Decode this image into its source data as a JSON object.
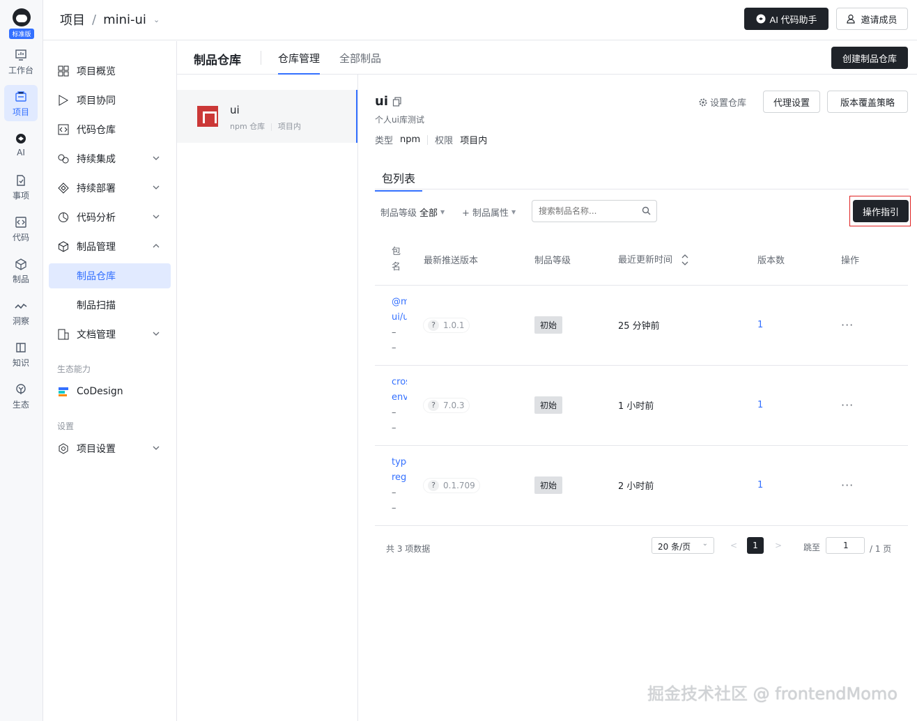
{
  "rail": {
    "edition": "标准版",
    "items": [
      {
        "label": "工作台",
        "icon": "workbench-icon"
      },
      {
        "label": "项目",
        "icon": "project-icon"
      },
      {
        "label": "AI",
        "icon": "ai-icon"
      },
      {
        "label": "事项",
        "icon": "issue-icon"
      },
      {
        "label": "代码",
        "icon": "code-icon"
      },
      {
        "label": "制品",
        "icon": "artifact-icon"
      },
      {
        "label": "洞察",
        "icon": "insight-icon"
      },
      {
        "label": "知识",
        "icon": "knowledge-icon"
      },
      {
        "label": "生态",
        "icon": "ecosystem-icon"
      }
    ]
  },
  "header": {
    "breadcrumb_root": "项目",
    "separator": "/",
    "project": "mini-ui",
    "ai_button": "AI 代码助手",
    "invite_button": "邀请成员"
  },
  "sidebar": {
    "items": [
      {
        "label": "项目概览"
      },
      {
        "label": "项目协同"
      },
      {
        "label": "代码仓库"
      },
      {
        "label": "持续集成"
      },
      {
        "label": "持续部署"
      },
      {
        "label": "代码分析"
      },
      {
        "label": "制品管理"
      },
      {
        "label": "制品仓库"
      },
      {
        "label": "制品扫描"
      },
      {
        "label": "文档管理"
      }
    ],
    "group_eco": "生态能力",
    "codesign": "CoDesign",
    "group_settings": "设置",
    "settings": "项目设置"
  },
  "tabbar": {
    "title": "制品仓库",
    "tab_manage": "仓库管理",
    "tab_all": "全部制品",
    "create_button": "创建制品仓库"
  },
  "repo": {
    "name": "ui",
    "type_label": "npm 仓库",
    "scope_label": "项目内"
  },
  "detail": {
    "name": "ui",
    "desc": "个人ui库测试",
    "type_key": "类型",
    "type_val": "npm",
    "perm_key": "权限",
    "perm_val": "项目内",
    "settings_link": "设置仓库",
    "proxy_button": "代理设置",
    "policy_button": "版本覆盖策略",
    "subtab": "包列表",
    "filter_level_key": "制品等级",
    "filter_level_val": "全部",
    "filter_attr": "+ 制品属性",
    "search_placeholder": "搜索制品名称...",
    "guide_button": "操作指引"
  },
  "table": {
    "headers": [
      "包名",
      "最新推送版本",
      "制品等级",
      "最近更新时间",
      "版本数",
      "操作"
    ],
    "rows": [
      {
        "name1": "@mini",
        "name2": "ui/ui",
        "ver": "1.0.1",
        "level": "初始",
        "time": "25 分钟前",
        "count": "1",
        "ops": "···"
      },
      {
        "name1": "cross",
        "name2": "env",
        "ver": "7.0.3",
        "level": "初始",
        "time": "1 小时前",
        "count": "1",
        "ops": "···"
      },
      {
        "name1": "typed",
        "name2": "reg",
        "ver": "0.1.709",
        "level": "初始",
        "time": "2 小时前",
        "count": "1",
        "ops": "···"
      }
    ]
  },
  "pager": {
    "total": "共 3 项数据",
    "size": "20 条/页",
    "prev": "<",
    "current": "1",
    "next": ">",
    "jump_label": "跳至",
    "jump_value": "1",
    "of": "/ 1 页"
  },
  "watermark": "掘金技术社区 @ frontendMomo"
}
